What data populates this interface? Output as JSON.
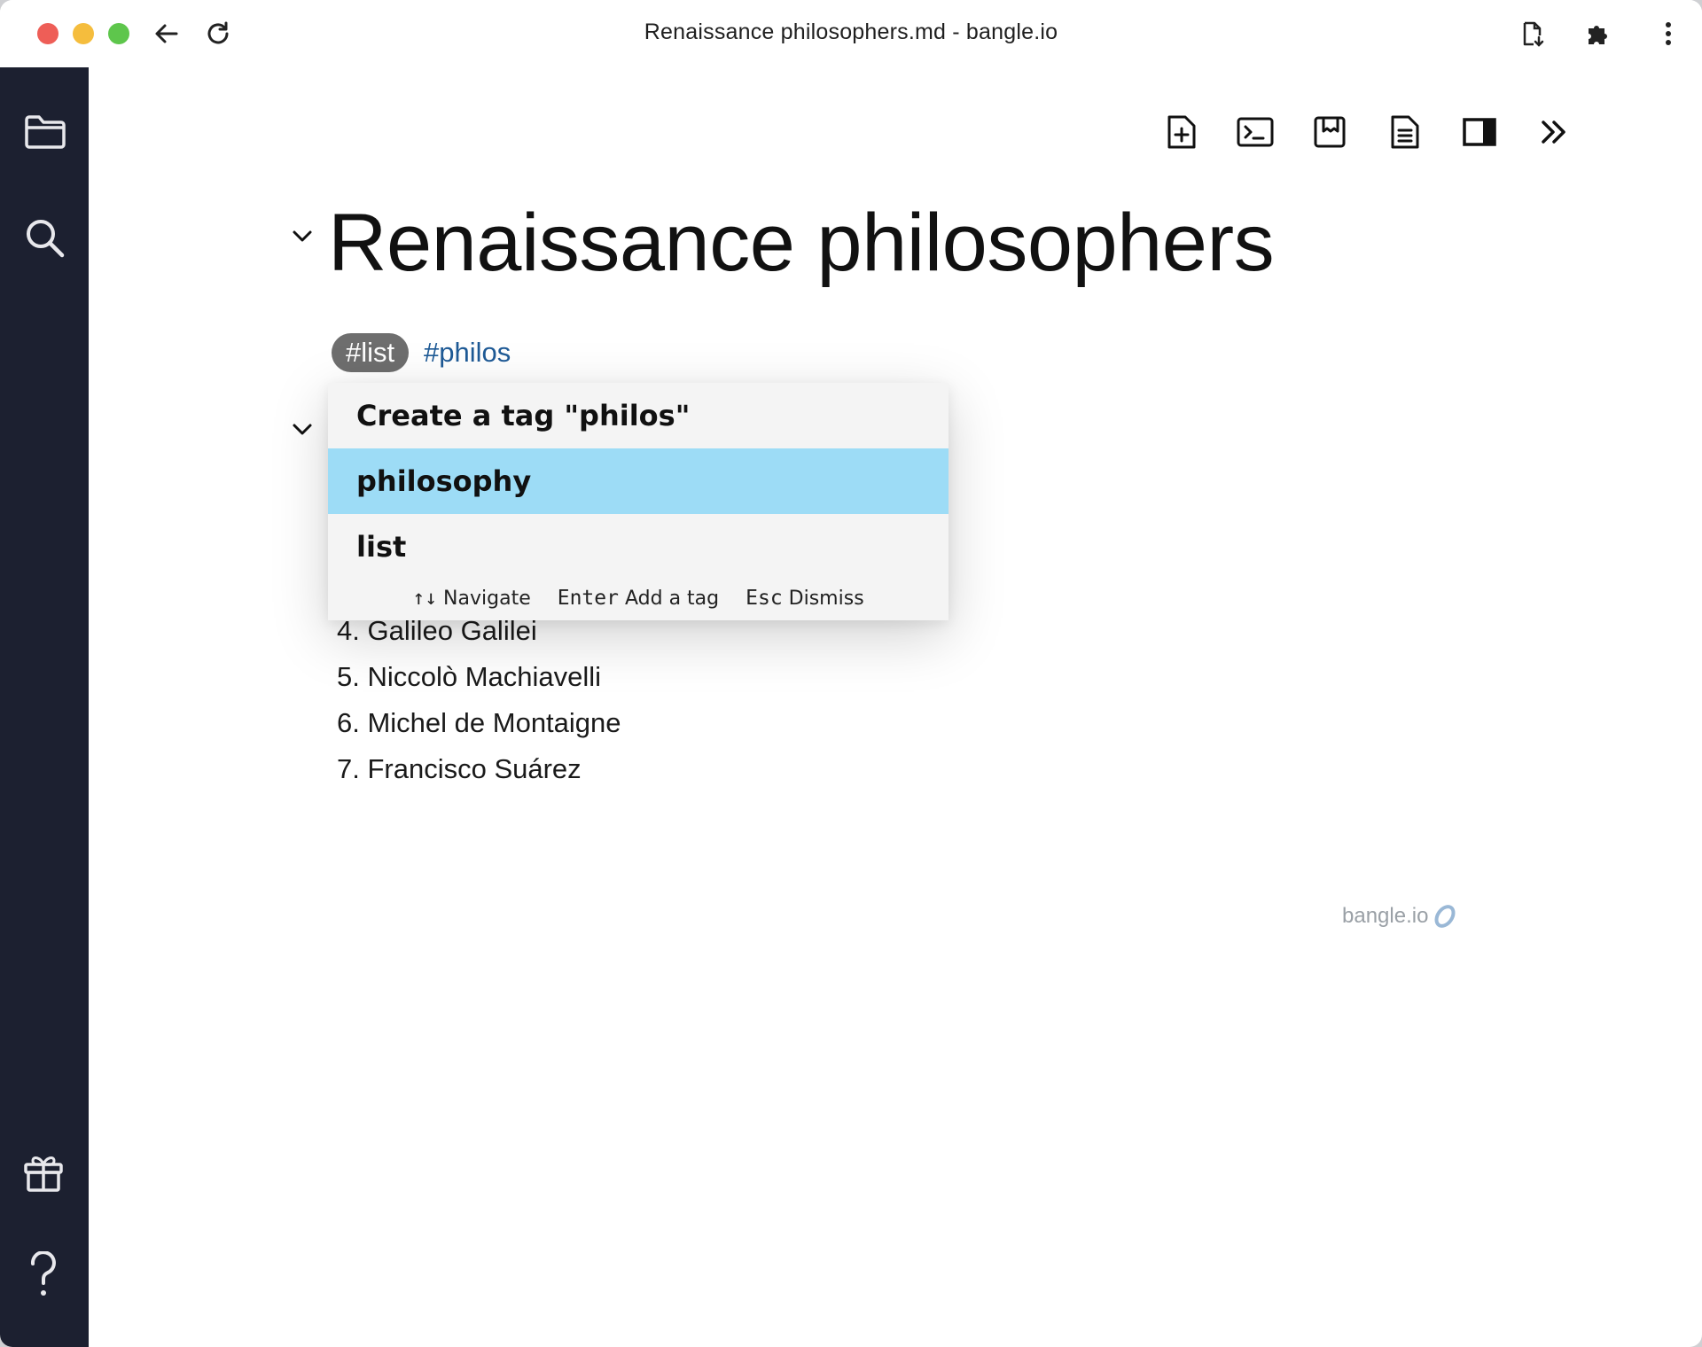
{
  "window": {
    "title": "Renaissance philosophers.md - bangle.io"
  },
  "document": {
    "title": "Renaissance philosophers",
    "tag_pill": "#list",
    "tag_typing": "#philos",
    "list_items": [
      "4. Galileo Galilei",
      "5. Niccolò Machiavelli",
      "6. Michel de Montaigne",
      "7. Francisco Suárez"
    ]
  },
  "tag_popup": {
    "items": [
      {
        "label": "Create a tag \"philos\"",
        "selected": false
      },
      {
        "label": "philosophy",
        "selected": true
      },
      {
        "label": "list",
        "selected": false
      }
    ],
    "hints": [
      {
        "key": "↑↓",
        "label": "Navigate"
      },
      {
        "key": "Enter",
        "label": "Add a tag"
      },
      {
        "key": "Esc",
        "label": "Dismiss"
      }
    ]
  },
  "branding": {
    "text": "bangle.io"
  },
  "colors": {
    "sidebar": "#1c2030",
    "selected_row": "#9ddcf6",
    "tag_pill": "#6e6e6e",
    "tag_text": "#1e5a96"
  }
}
